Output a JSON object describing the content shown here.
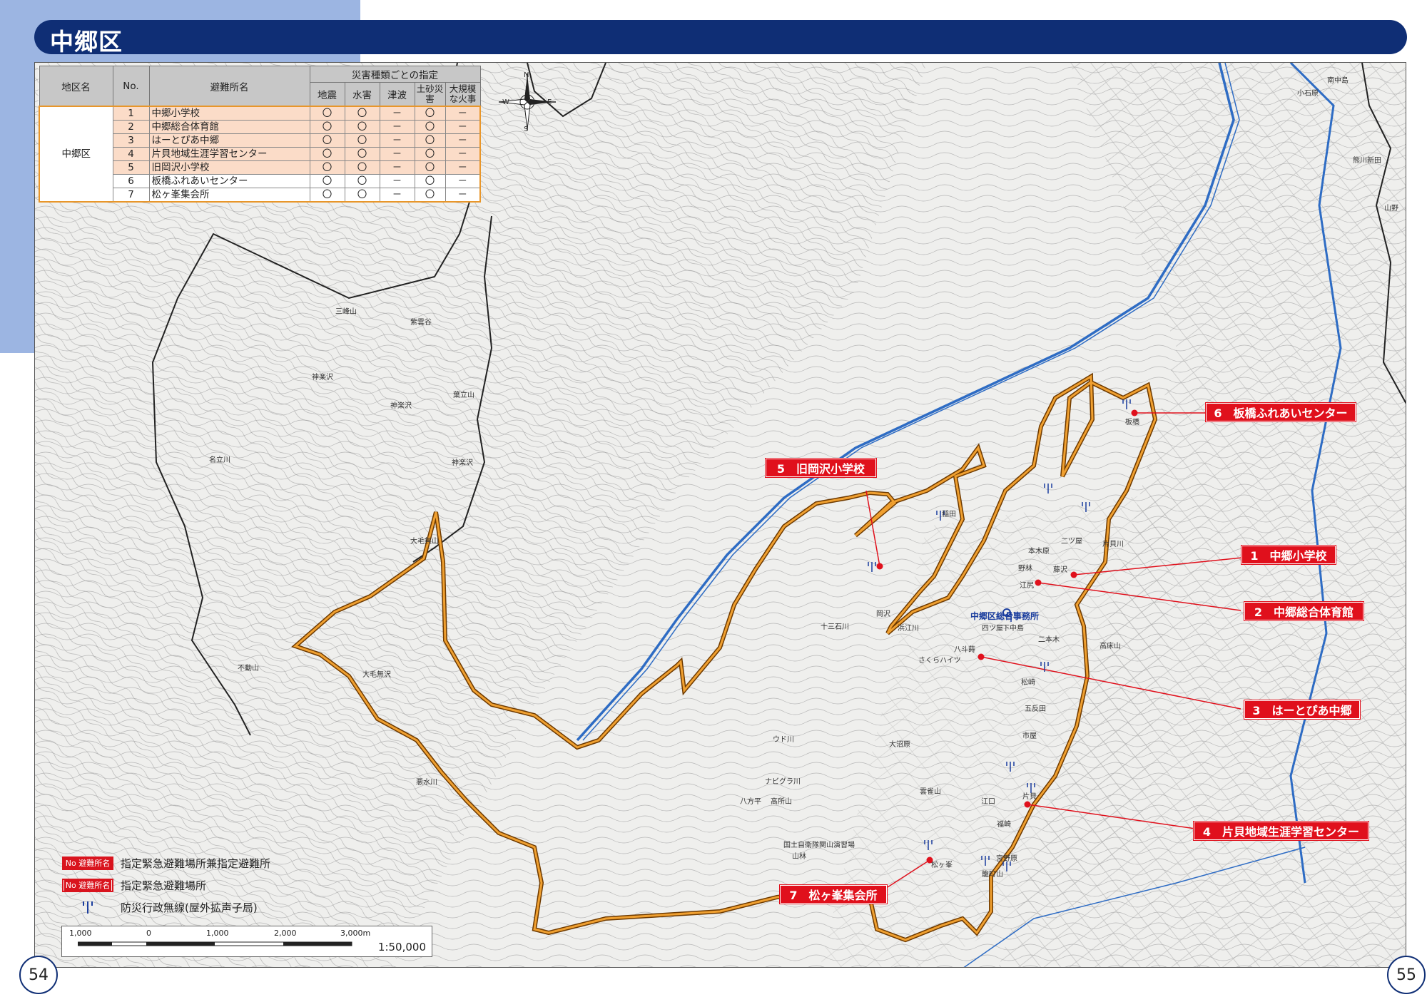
{
  "header": {
    "title": "中郷区"
  },
  "colors": {
    "title_bar": "#0f2e75",
    "corner": "#9cb5e2",
    "boundary": "#e8962a",
    "river": "#2e6cc4",
    "callout": "#e0101c"
  },
  "table": {
    "headers": {
      "district": "地区名",
      "no": "No.",
      "name": "避難所名",
      "group": "災害種類ごとの指定"
    },
    "hazards": [
      "地震",
      "水害",
      "津波",
      "土砂災害",
      "大規模な火事"
    ],
    "district": "中郷区",
    "rows": [
      {
        "no": "1",
        "name": "中郷小学校",
        "marks": [
          "〇",
          "〇",
          "－",
          "〇",
          "－"
        ],
        "highlight": true
      },
      {
        "no": "2",
        "name": "中郷総合体育館",
        "marks": [
          "〇",
          "〇",
          "－",
          "〇",
          "－"
        ],
        "highlight": true
      },
      {
        "no": "3",
        "name": "はーとぴあ中郷",
        "marks": [
          "〇",
          "〇",
          "－",
          "〇",
          "－"
        ],
        "highlight": true
      },
      {
        "no": "4",
        "name": "片貝地域生涯学習センター",
        "marks": [
          "〇",
          "〇",
          "－",
          "〇",
          "－"
        ],
        "highlight": true
      },
      {
        "no": "5",
        "name": "旧岡沢小学校",
        "marks": [
          "〇",
          "〇",
          "－",
          "〇",
          "－"
        ],
        "highlight": true
      },
      {
        "no": "6",
        "name": "板橋ふれあいセンター",
        "marks": [
          "〇",
          "〇",
          "－",
          "〇",
          "－"
        ],
        "highlight": false
      },
      {
        "no": "7",
        "name": "松ヶ峯集会所",
        "marks": [
          "〇",
          "〇",
          "－",
          "〇",
          "－"
        ],
        "highlight": false
      }
    ]
  },
  "compass": {
    "n": "N",
    "s": "S",
    "e": "E",
    "w": "W"
  },
  "callouts": [
    {
      "label": "6　板橋ふれあいセンター"
    },
    {
      "label": "5　旧岡沢小学校"
    },
    {
      "label": "1　中郷小学校"
    },
    {
      "label": "2　中郷総合体育館"
    },
    {
      "label": "3　はーとぴあ中郷"
    },
    {
      "label": "4　片貝地域生涯学習センター"
    },
    {
      "label": "7　松ヶ峯集会所"
    }
  ],
  "place_labels": [
    "三峰山",
    "紫雲谷",
    "神楽沢",
    "神楽沢",
    "葉立山",
    "名立川",
    "神楽沢",
    "大毛無山",
    "不動山",
    "大毛無沢",
    "悪水川",
    "十三石川",
    "浜江川",
    "ウド川",
    "ナビグラ川",
    "高所山",
    "八方平",
    "大沼原",
    "雲雀山",
    "江口",
    "福崎",
    "宮野原",
    "籠町山",
    "片貝",
    "市屋",
    "五反田",
    "松崎",
    "高床山",
    "二本木",
    "四ツ屋",
    "下中島",
    "稲田",
    "岡沢",
    "板橋",
    "片貝川",
    "野林",
    "江尻",
    "藤沢",
    "二ツ屋",
    "本木原",
    "八斗蒔",
    "さくらハイツ",
    "関川",
    "松ヶ峯",
    "国土自衛隊関山演習場",
    "山林",
    "小石原",
    "南中島",
    "熊川新田",
    "梨木",
    "山野"
  ],
  "office": "中郷区総合事務所",
  "legend": {
    "box_text": "No 避難所名",
    "item1": "指定緊急避難場所兼指定避難所",
    "item2": "指定緊急避難場所",
    "item3": "防災行政無線(屋外拡声子局)"
  },
  "scale": {
    "ticks": [
      "1,000",
      "0",
      "1,000",
      "2,000",
      "3,000m"
    ],
    "ratio": "1:50,000"
  },
  "pages": {
    "left": "54",
    "right": "55"
  }
}
